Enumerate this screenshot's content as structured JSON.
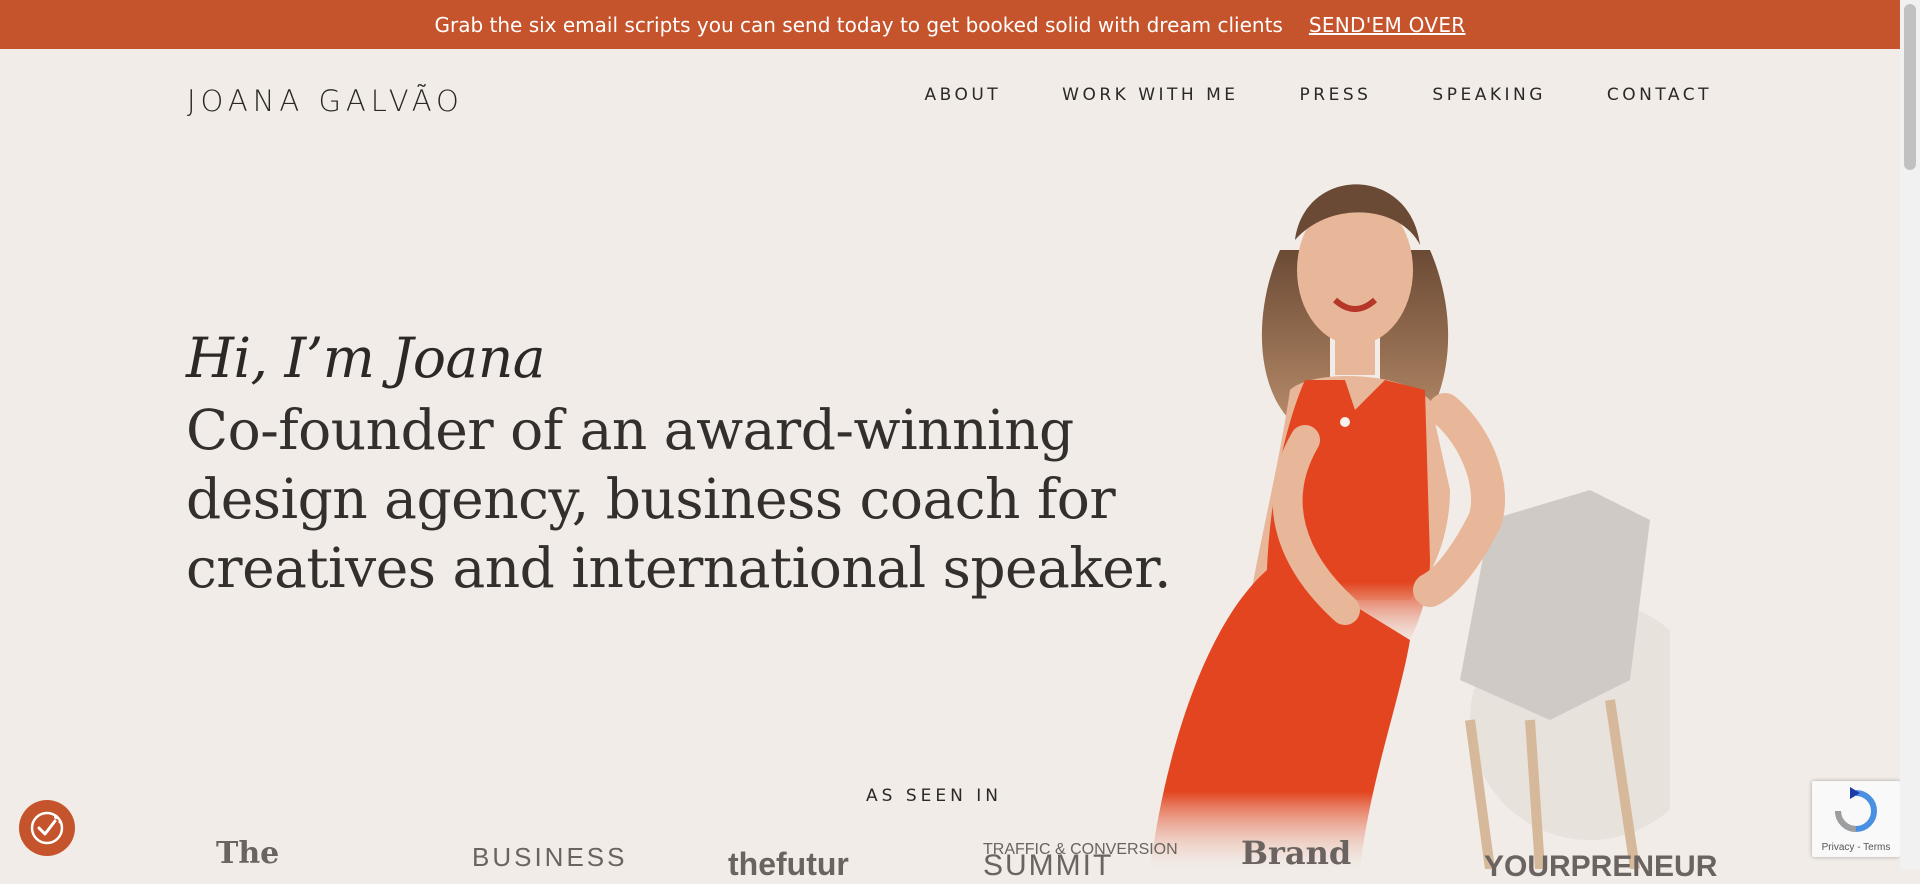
{
  "banner": {
    "message": "Grab the six email scripts you can send today to get booked solid with dream clients",
    "cta": "SEND'EM OVER"
  },
  "header": {
    "logo": "JOANA GALVÃO",
    "nav": [
      "ABOUT",
      "WORK WITH ME",
      "PRESS",
      "SPEAKING",
      "CONTACT"
    ]
  },
  "hero": {
    "greeting": "Hi, I’m Joana",
    "lines": [
      "Co-founder of an award-winning",
      "design agency, business coach for",
      "creatives and international speaker."
    ]
  },
  "press": {
    "heading": "AS SEEN IN",
    "logos": [
      {
        "text": "The",
        "icon": "the-logo"
      },
      {
        "text": "BUSINESS",
        "icon": "business-logo"
      },
      {
        "text": "thefutur",
        "icon": "thefutur-logo"
      },
      {
        "text_top": "TRAFFIC & CONVERSION",
        "text_bottom": "SUMMIT",
        "icon": "traffic-conversion-summit-logo"
      },
      {
        "text": "Brand",
        "icon": "brand-logo"
      },
      {
        "text": "YOURPRENEUR",
        "icon": "yourpreneur-logo"
      }
    ]
  },
  "recaptcha": {
    "terms": "Privacy - Terms"
  },
  "colors": {
    "accent": "#c5532b",
    "background": "#f1ece7",
    "text": "#2b2826"
  }
}
